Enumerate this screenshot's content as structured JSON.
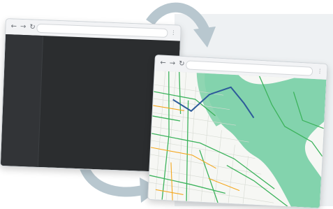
{
  "scene": {
    "accent_green": "#5fc49a",
    "road_green": "#3cb35c",
    "road_orange": "#f4a71d",
    "route_blue": "#2d5b9a",
    "arrow_color": "#b8c7cf",
    "editor_bg": "#2b2d2f"
  },
  "code_window": {
    "nav_back": "←",
    "nav_forward": "→",
    "nav_reload": "↻",
    "menu_icon": "⋮"
  },
  "map_window": {
    "nav_back": "←",
    "nav_forward": "→",
    "nav_reload": "↻",
    "menu_icon": "⋮"
  },
  "icons": [
    "back-icon",
    "forward-icon",
    "reload-icon",
    "menu-icon",
    "curved-arrow-icon"
  ]
}
